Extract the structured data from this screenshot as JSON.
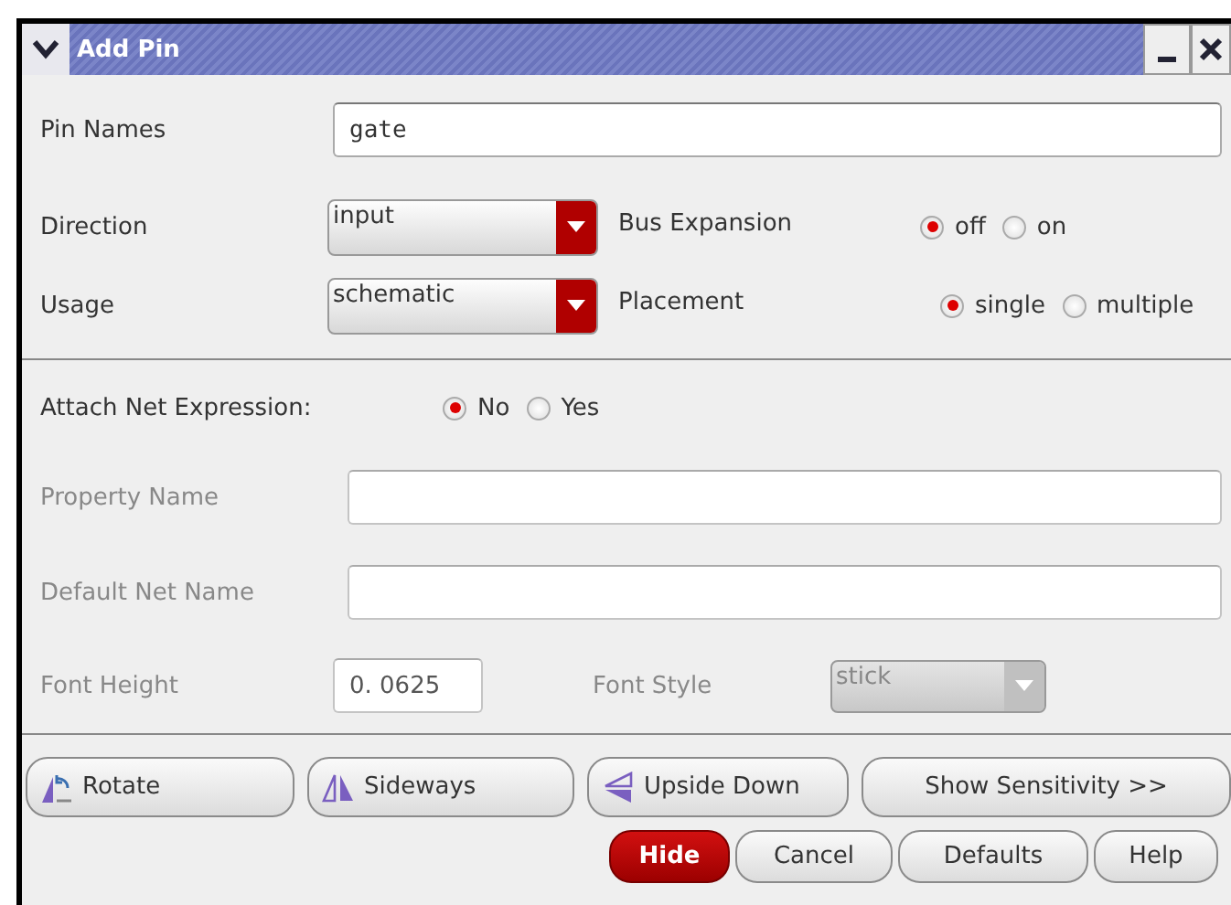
{
  "window": {
    "title": "Add Pin"
  },
  "pin_names": {
    "label": "Pin Names",
    "value": "gate"
  },
  "direction": {
    "label": "Direction",
    "value": "input",
    "disabled": false
  },
  "bus_expansion": {
    "label": "Bus Expansion",
    "options": [
      {
        "label": "off",
        "selected": true
      },
      {
        "label": "on",
        "selected": false
      }
    ]
  },
  "usage": {
    "label": "Usage",
    "value": "schematic",
    "disabled": false
  },
  "placement": {
    "label": "Placement",
    "options": [
      {
        "label": "single",
        "selected": true
      },
      {
        "label": "multiple",
        "selected": false
      }
    ]
  },
  "attach_net_expression": {
    "label": "Attach Net Expression:",
    "options": [
      {
        "label": "No",
        "selected": true
      },
      {
        "label": "Yes",
        "selected": false
      }
    ]
  },
  "property_name": {
    "label": "Property Name",
    "disabled": true
  },
  "default_net_name": {
    "label": "Default Net Name",
    "disabled": true
  },
  "font_height": {
    "label": "Font Height",
    "value": "0. 0625",
    "disabled": true
  },
  "font_style": {
    "label": "Font Style",
    "value": "stick",
    "disabled": true
  },
  "tool_buttons": [
    {
      "label": "Rotate",
      "kind": "rotate"
    },
    {
      "label": "Sideways",
      "kind": "sideways"
    },
    {
      "label": "Upside Down",
      "kind": "upside"
    },
    {
      "label": "Show Sensitivity >>",
      "kind": "plain"
    }
  ],
  "buttons": [
    {
      "label": "Hide",
      "kind": "primary"
    },
    {
      "label": "Cancel",
      "kind": "normal"
    },
    {
      "label": "Defaults",
      "kind": "normal"
    },
    {
      "label": "Help",
      "kind": "normal"
    }
  ]
}
